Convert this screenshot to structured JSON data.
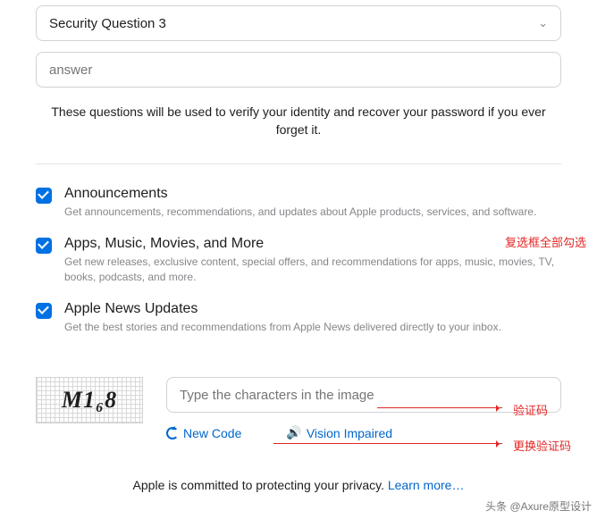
{
  "security": {
    "question_label": "Security Question 3",
    "answer_placeholder": "answer",
    "helper": "These questions will be used to verify your identity and recover your password if you ever forget it."
  },
  "subscriptions": {
    "items": [
      {
        "title": "Announcements",
        "desc": "Get announcements, recommendations, and updates about Apple products, services, and software."
      },
      {
        "title": "Apps, Music, Movies, and More",
        "desc": "Get new releases, exclusive content, special offers, and recommendations for apps, music, movies, TV, books, podcasts, and more."
      },
      {
        "title": "Apple News Updates",
        "desc": "Get the best stories and recommendations from Apple News delivered directly to your inbox."
      }
    ]
  },
  "captcha": {
    "code": "M1₆8",
    "placeholder": "Type the characters in the image",
    "new_code": "New Code",
    "vision_impaired": "Vision Impaired"
  },
  "footer": {
    "text": "Apple is committed to protecting your privacy. ",
    "link": "Learn more…"
  },
  "annotations": {
    "checkbox_note": "复选框全部勾选",
    "captcha_note": "验证码",
    "refresh_note": "更换验证码"
  },
  "watermark": "头条 @Axure原型设计"
}
